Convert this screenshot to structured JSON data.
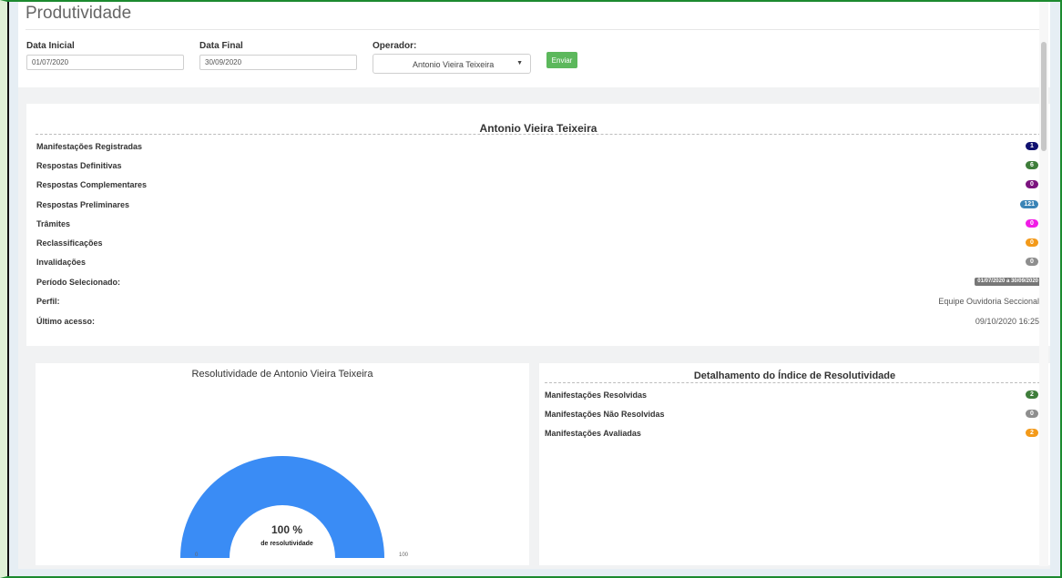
{
  "header": {
    "title": "Produtividade",
    "data_inicial_label": "Data Inicial",
    "data_inicial_value": "01/07/2020",
    "data_final_label": "Data Final",
    "data_final_value": "30/09/2020",
    "operador_label": "Operador:",
    "operador_value": "Antonio Vieira Teixeira",
    "submit_label": "Enviar"
  },
  "stats": {
    "name": "Antonio Vieira Teixeira",
    "rows": [
      {
        "label": "Manifestações Registradas",
        "value": "1",
        "color": "#101170"
      },
      {
        "label": "Respostas Definitivas",
        "value": "6",
        "color": "#3e7d3a"
      },
      {
        "label": "Respostas Complementares",
        "value": "0",
        "color": "#7b137e"
      },
      {
        "label": "Respostas Preliminares",
        "value": "121",
        "color": "#3a84b6"
      },
      {
        "label": "Trâmites",
        "value": "0",
        "color": "#f11ce6"
      },
      {
        "label": "Reclassificações",
        "value": "0",
        "color": "#f39a1a"
      },
      {
        "label": "Invalidações",
        "value": "0",
        "color": "#8e8e8e"
      }
    ],
    "periodo_label": "Período Selecionado:",
    "periodo_value": "01/07/2020 a 30/09/2020",
    "perfil_label": "Perfil:",
    "perfil_value": "Equipe Ouvidoria Seccional",
    "ultimo_acesso_label": "Último acesso:",
    "ultimo_acesso_value": "09/10/2020 16:25"
  },
  "gauge": {
    "title": "Resolutividade de Antonio Vieira Teixeira",
    "value": 100,
    "value_text": "100 %",
    "subtitle": "de resolutividade",
    "min": "0",
    "max": "100",
    "color": "#3a8cf5"
  },
  "detail": {
    "title": "Detalhamento do Índice de Resolutividade",
    "rows": [
      {
        "label": "Manifestações Resolvidas",
        "value": "2",
        "color": "#3e7d3a"
      },
      {
        "label": "Manifestações Não Resolvidas",
        "value": "0",
        "color": "#8e8e8e"
      },
      {
        "label": "Manifestações Avaliadas",
        "value": "2",
        "color": "#f39a1a"
      }
    ]
  }
}
